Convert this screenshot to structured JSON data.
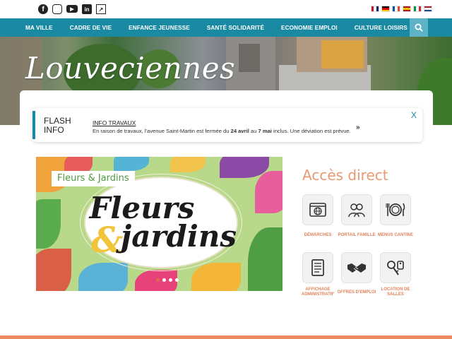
{
  "social": [
    "facebook-icon",
    "instagram-icon",
    "youtube-icon",
    "linkedin-icon",
    "external-link-icon"
  ],
  "languages": [
    "en",
    "de",
    "fr",
    "es",
    "it",
    "nl"
  ],
  "nav": {
    "items": [
      "MA VILLE",
      "CADRE DE VIE",
      "ENFANCE JEUNESSE",
      "SANTÉ SOLIDARITÉ",
      "ECONOMIE EMPLOI",
      "CULTURE LOISIRS"
    ]
  },
  "hero": {
    "town": "Louveciennes"
  },
  "flash": {
    "title_line1": "FLASH",
    "title_line2": "INFO",
    "headline": "INFO TRAVAUX",
    "text_a": "En raison de travaux, l'avenue Saint-Martin est fermée du ",
    "date_a": "24 avril",
    "text_b": " au ",
    "date_b": "7 mai",
    "text_c": " inclus. Une déviation est prévue.",
    "close": "X"
  },
  "slide": {
    "tag": "Fleurs & Jardins",
    "word1": "Fleurs",
    "amp": "&",
    "word2": "jardins"
  },
  "acces": {
    "title": "Accès direct",
    "tiles": [
      {
        "label": "DÉMARCHES",
        "icon": "browser-globe-icon"
      },
      {
        "label": "PORTAIL FAMILLE",
        "icon": "family-icon"
      },
      {
        "label": "MENUS CANTINE",
        "icon": "cutlery-plate-icon"
      },
      {
        "label": "AFFICHAGE ADMINISTRATIF",
        "icon": "document-icon"
      },
      {
        "label": "OFFRES D'EMPLOI",
        "icon": "handshake-icon"
      },
      {
        "label": "LOCATION DE SALLES",
        "icon": "keys-icon"
      }
    ]
  },
  "colors": {
    "primary": "#1a8aa3",
    "accent": "#e89a73",
    "footer": "#ee8a5f"
  }
}
